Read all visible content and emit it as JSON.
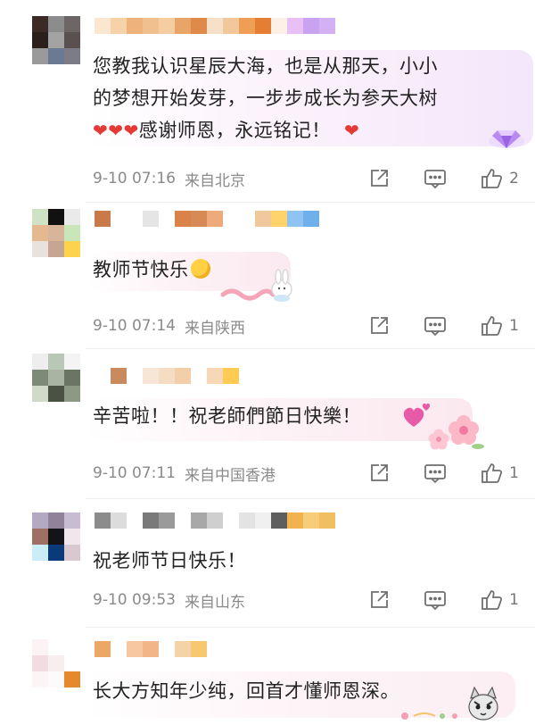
{
  "comments": [
    {
      "text_lines": [
        "您教我认识星辰大海，也是从那天，小小",
        "的梦想开始发芽，一步步成长为参天大树"
      ],
      "text_tail": "感谢师恩，永远铭记！",
      "time": "9-10 07:16",
      "location": "来自北京",
      "likes": "2"
    },
    {
      "text": "教师节快乐",
      "time": "9-10 07:14",
      "location": "来自陕西",
      "likes": "1"
    },
    {
      "text": "辛苦啦！！祝老師們節日快樂！",
      "time": "9-10 07:11",
      "location": "来自中国香港",
      "likes": "1"
    },
    {
      "text": "祝老师节日快乐！",
      "time": "9-10 09:53",
      "location": "来自山东",
      "likes": "1"
    },
    {
      "text": "长大方知年少纯，回首才懂师恩深。"
    }
  ],
  "icons": {
    "share": "share-icon",
    "reply": "comment-icon",
    "like": "thumbs-up-icon",
    "heart": "red-heart-emoji"
  },
  "colors": {
    "text": "#222222",
    "meta": "#8a8a8a",
    "bubble_pink": "#fdeef3"
  }
}
